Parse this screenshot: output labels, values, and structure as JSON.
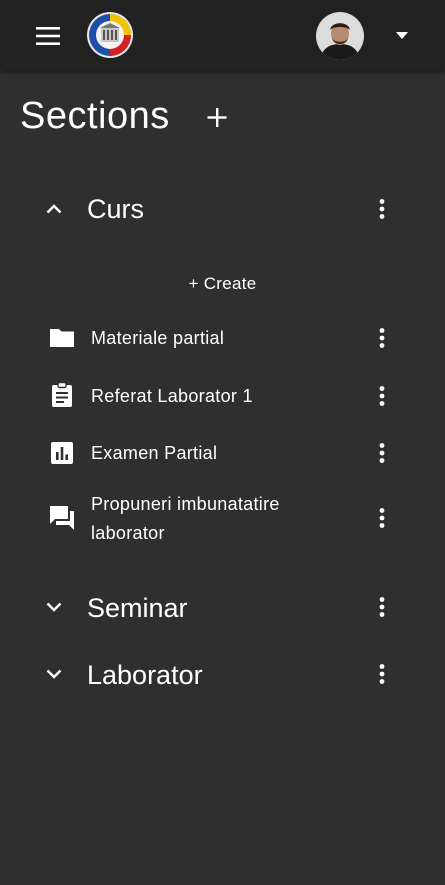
{
  "header": {
    "menu_icon": "hamburger-menu-icon",
    "logo_icon": "university-logo",
    "avatar_icon": "user-avatar",
    "dropdown_icon": "caret-down-icon"
  },
  "page": {
    "title": "Sections",
    "add_icon": "plus-icon"
  },
  "sections": [
    {
      "name": "Curs",
      "expanded": true,
      "create_label": "+ Create",
      "items": [
        {
          "label": "Materiale partial",
          "icon": "folder-icon"
        },
        {
          "label": "Referat Laborator 1",
          "icon": "assignment-icon"
        },
        {
          "label": "Examen Partial",
          "icon": "quiz-chart-icon"
        },
        {
          "label": "Propuneri imbunatatire laborator",
          "icon": "forum-icon"
        }
      ]
    },
    {
      "name": "Seminar",
      "expanded": false
    },
    {
      "name": "Laborator",
      "expanded": false
    }
  ],
  "colors": {
    "background": "#2f2f2f",
    "topbar": "#222222",
    "text": "#ffffff"
  }
}
